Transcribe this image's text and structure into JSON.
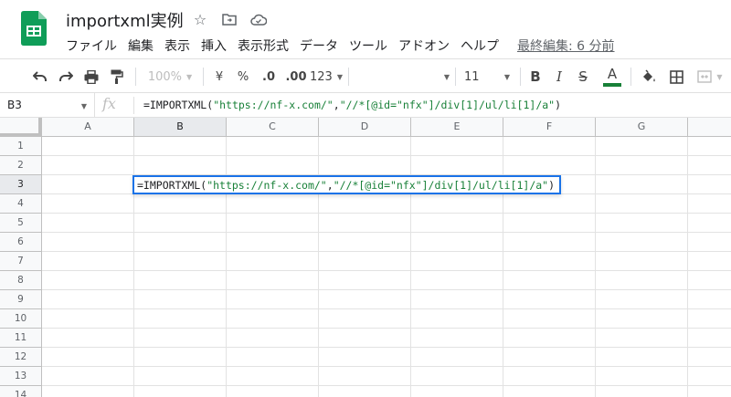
{
  "header": {
    "doc_title": "importxml実例",
    "menu": [
      "ファイル",
      "編集",
      "表示",
      "挿入",
      "表示形式",
      "データ",
      "ツール",
      "アドオン",
      "ヘルプ"
    ],
    "last_edit": "最終編集: 6 分前"
  },
  "toolbar": {
    "zoom": "100%",
    "currency": "¥",
    "percent": "%",
    "decrease_decimal": ".0",
    "increase_decimal": ".00",
    "number_format": "123",
    "font_size": "11",
    "bold": "B",
    "italic": "I",
    "strikethrough": "S",
    "text_color_letter": "A",
    "text_color": "#188038"
  },
  "formula_bar": {
    "cell_ref": "B3",
    "fx_label": "fx",
    "fn_name": "=IMPORTXML",
    "paren_open": "(",
    "url": "\"https://nf-x.com/\"",
    "comma": ",",
    "xpath": "\"//*[@id=\"nfx\"]/div[1]/ul/li[1]/a\"",
    "paren_close": ")"
  },
  "grid": {
    "columns": [
      "A",
      "B",
      "C",
      "D",
      "E",
      "F",
      "G"
    ],
    "rows": [
      "1",
      "2",
      "3",
      "4",
      "5",
      "6",
      "7",
      "8",
      "9",
      "10",
      "11",
      "12",
      "13",
      "14"
    ],
    "selected_column": "B",
    "selected_row": "3"
  },
  "colors": {
    "accent": "#1a73e8",
    "string_literal": "#188038",
    "sheets_green": "#0f9d58"
  }
}
